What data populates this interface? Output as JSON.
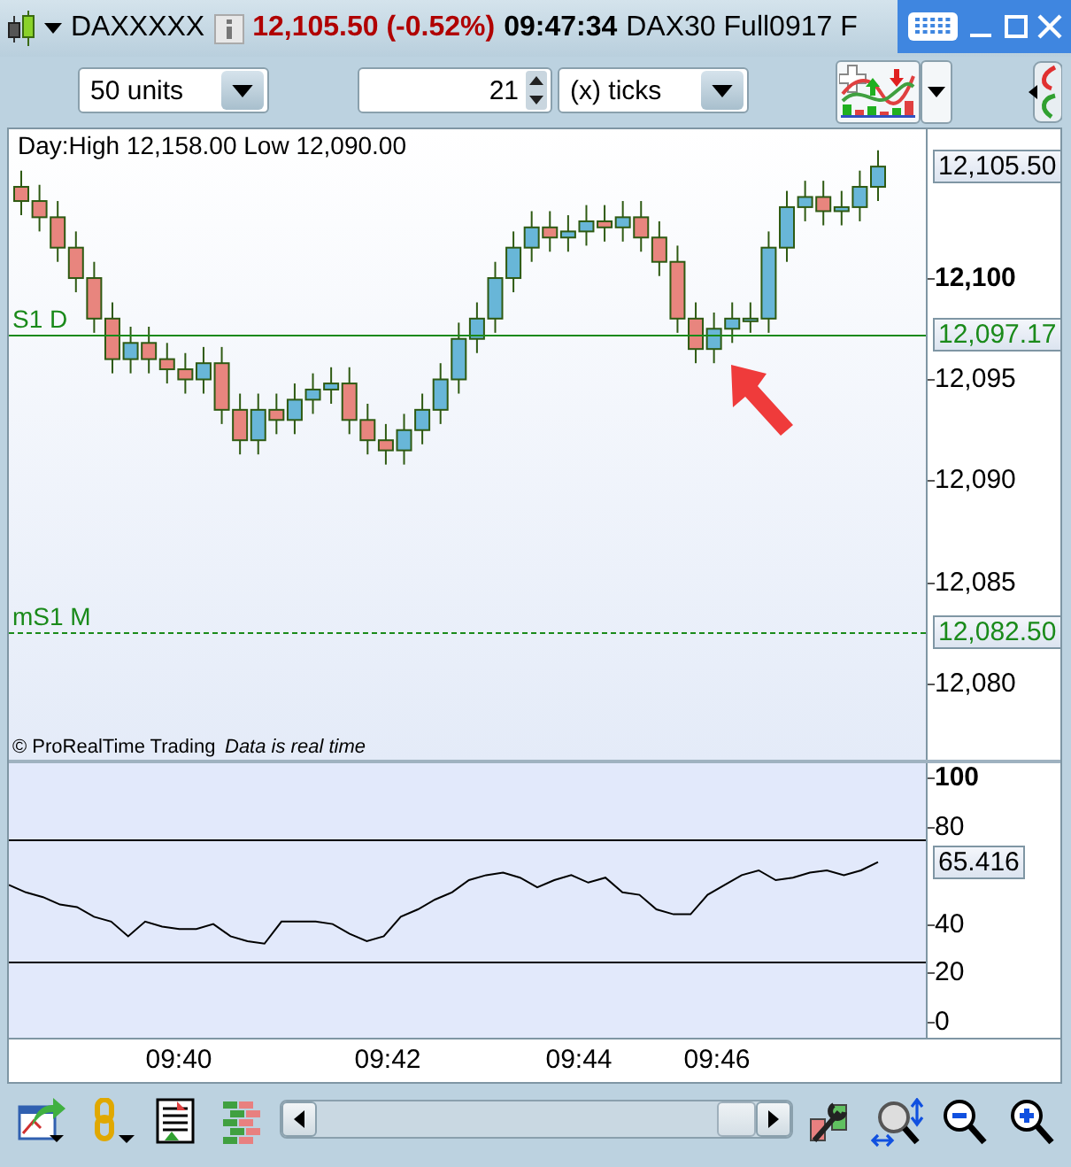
{
  "title_bar": {
    "instrument": "DAXXXXX",
    "price_change": "12,105.50 (-0.52%)",
    "time": "09:47:34",
    "description": "DAX30 Full0917 F"
  },
  "toolbar": {
    "quantity": "50 units",
    "tick_count": "21",
    "tick_unit": "(x) ticks"
  },
  "price_chart": {
    "day_range": "Day:High 12,158.00 Low 12,090.00",
    "chart_data": {
      "type": "candlestick",
      "ylim": [
        12076.24,
        12107.34
      ],
      "ref_lines": [
        {
          "axis": "y",
          "value": 12097.17
        },
        {
          "axis": "y",
          "value": 12082.5
        }
      ],
      "yticks": [
        {
          "value": 12100,
          "label": "12,100"
        },
        {
          "value": 12095,
          "label": "12,095"
        },
        {
          "value": 12090,
          "label": "12,090"
        },
        {
          "value": 12085,
          "label": "12,085"
        },
        {
          "value": 12080,
          "label": "12,080"
        }
      ],
      "ohlc": [
        [
          12104.5,
          12105.3,
          12103.1,
          12103.8
        ],
        [
          12103.8,
          12104.6,
          12102.3,
          12103
        ],
        [
          12103,
          12103.8,
          12100.8,
          12101.5
        ],
        [
          12101.5,
          12102.3,
          12099.3,
          12100
        ],
        [
          12100,
          12100.8,
          12097.3,
          12098
        ],
        [
          12098,
          12098.8,
          12095.3,
          12096
        ],
        [
          12096,
          12097.6,
          12095.3,
          12096.8
        ],
        [
          12096.8,
          12097.6,
          12095.3,
          12096
        ],
        [
          12096,
          12096.8,
          12094.8,
          12095.5
        ],
        [
          12095.5,
          12096.3,
          12094.3,
          12095
        ],
        [
          12095,
          12096.6,
          12094.3,
          12095.8
        ],
        [
          12095.8,
          12096.6,
          12092.8,
          12093.5
        ],
        [
          12093.5,
          12094.3,
          12091.3,
          12092
        ],
        [
          12092,
          12094.3,
          12091.3,
          12093.5
        ],
        [
          12093.5,
          12094.3,
          12092.3,
          12093
        ],
        [
          12093,
          12094.8,
          12092.3,
          12094
        ],
        [
          12094,
          12095.3,
          12093.3,
          12094.5
        ],
        [
          12094.5,
          12095.6,
          12093.8,
          12094.8
        ],
        [
          12094.8,
          12095.6,
          12092.3,
          12093
        ],
        [
          12093,
          12093.8,
          12091.3,
          12092
        ],
        [
          12092,
          12092.8,
          12090.8,
          12091.5
        ],
        [
          12091.5,
          12093.3,
          12090.8,
          12092.5
        ],
        [
          12092.5,
          12094.3,
          12091.8,
          12093.5
        ],
        [
          12093.5,
          12095.8,
          12092.8,
          12095
        ],
        [
          12095,
          12097.8,
          12094.3,
          12097
        ],
        [
          12097,
          12098.8,
          12096.3,
          12098
        ],
        [
          12098,
          12100.8,
          12097.3,
          12100
        ],
        [
          12100,
          12102.3,
          12099.3,
          12101.5
        ],
        [
          12101.5,
          12103.3,
          12100.8,
          12102.5
        ],
        [
          12102.5,
          12103.3,
          12101.3,
          12102
        ],
        [
          12102,
          12103.1,
          12101.3,
          12102.3
        ],
        [
          12102.3,
          12103.6,
          12101.6,
          12102.8
        ],
        [
          12102.8,
          12103.6,
          12101.8,
          12102.5
        ],
        [
          12102.5,
          12103.8,
          12101.8,
          12103
        ],
        [
          12103,
          12103.8,
          12101.3,
          12102
        ],
        [
          12102,
          12102.8,
          12100.1,
          12100.8
        ],
        [
          12100.8,
          12101.6,
          12097.3,
          12098
        ],
        [
          12098,
          12098.8,
          12095.8,
          12096.5
        ],
        [
          12096.5,
          12098.3,
          12095.8,
          12097.5
        ],
        [
          12097.5,
          12098.8,
          12096.8,
          12098
        ],
        [
          12098,
          12098.8,
          12097.3,
          12098
        ],
        [
          12098,
          12102.3,
          12097.3,
          12101.5
        ],
        [
          12101.5,
          12104.3,
          12100.8,
          12103.5
        ],
        [
          12103.5,
          12104.8,
          12102.8,
          12104
        ],
        [
          12104,
          12104.8,
          12102.6,
          12103.3
        ],
        [
          12103.3,
          12104.3,
          12102.6,
          12103.5
        ],
        [
          12103.5,
          12105.3,
          12102.8,
          12104.5
        ],
        [
          12104.5,
          12106.3,
          12103.8,
          12105.5
        ]
      ]
    },
    "last_price": "12,105.50",
    "levels": [
      {
        "kind": "daily",
        "name": "S1 D",
        "price": "12,097.17"
      },
      {
        "kind": "monthly",
        "name": "mS1 M",
        "price": "12,082.50"
      }
    ],
    "copyright": "© ProRealTime Trading",
    "data_notice": "Data is real time"
  },
  "oscillator": {
    "current_value": "65.416",
    "chart_data": {
      "type": "line",
      "ylim": [
        -6.5,
        105.8
      ],
      "ref_lines": [
        {
          "axis": "y",
          "value": 75
        },
        {
          "axis": "y",
          "value": 25
        }
      ],
      "yticks": [
        {
          "value": 0,
          "label": "0"
        },
        {
          "value": 20,
          "label": "20"
        },
        {
          "value": 40,
          "label": "40"
        },
        {
          "value": 80,
          "label": "80"
        },
        {
          "value": 100,
          "label": "100"
        }
      ],
      "series": [
        {
          "color": "#000000",
          "values": [
            56,
            53,
            51,
            48,
            47,
            43,
            41,
            35,
            41,
            39,
            38,
            38,
            40,
            35,
            33,
            32,
            41,
            41,
            41,
            40,
            36,
            33,
            35,
            43,
            46,
            50,
            53,
            58,
            60,
            61,
            59,
            55,
            58,
            60,
            57,
            59,
            53,
            52,
            46,
            44,
            44,
            52,
            56,
            60,
            62,
            58,
            59,
            61,
            62,
            60,
            62,
            65.4
          ]
        }
      ]
    }
  },
  "time_axis": [
    "09:40",
    "09:42",
    "09:44",
    "09:46"
  ]
}
